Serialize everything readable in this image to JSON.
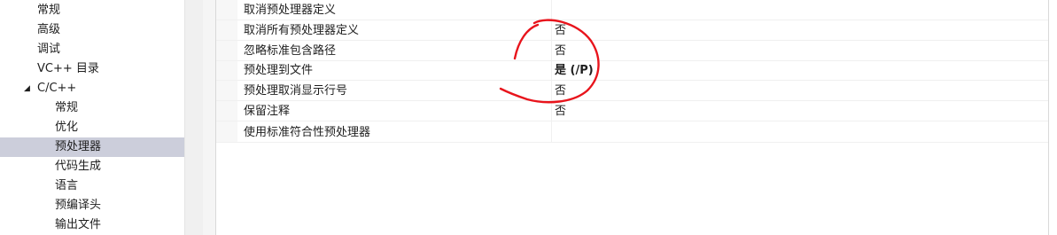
{
  "tree": {
    "items": [
      {
        "label": "常规"
      },
      {
        "label": "高级"
      },
      {
        "label": "调试"
      },
      {
        "label": "VC++ 目录"
      },
      {
        "label": "C/C++",
        "expander": "◢"
      },
      {
        "label": "常规"
      },
      {
        "label": "优化"
      },
      {
        "label": "预处理器",
        "selected": true
      },
      {
        "label": "代码生成"
      },
      {
        "label": "语言"
      },
      {
        "label": "预编译头"
      },
      {
        "label": "输出文件"
      }
    ]
  },
  "properties": {
    "rows": [
      {
        "name": "取消预处理器定义",
        "value": ""
      },
      {
        "name": "取消所有预处理器定义",
        "value": "否"
      },
      {
        "name": "忽略标准包含路径",
        "value": "否"
      },
      {
        "name": "预处理到文件",
        "value": "是 (/P)",
        "bold": true
      },
      {
        "name": "预处理取消显示行号",
        "value": "否"
      },
      {
        "name": "保留注释",
        "value": "否"
      },
      {
        "name": "使用标准符合性预处理器",
        "value": ""
      }
    ]
  },
  "colors": {
    "selection": "#cccedb",
    "annotation": "#e8141c"
  }
}
